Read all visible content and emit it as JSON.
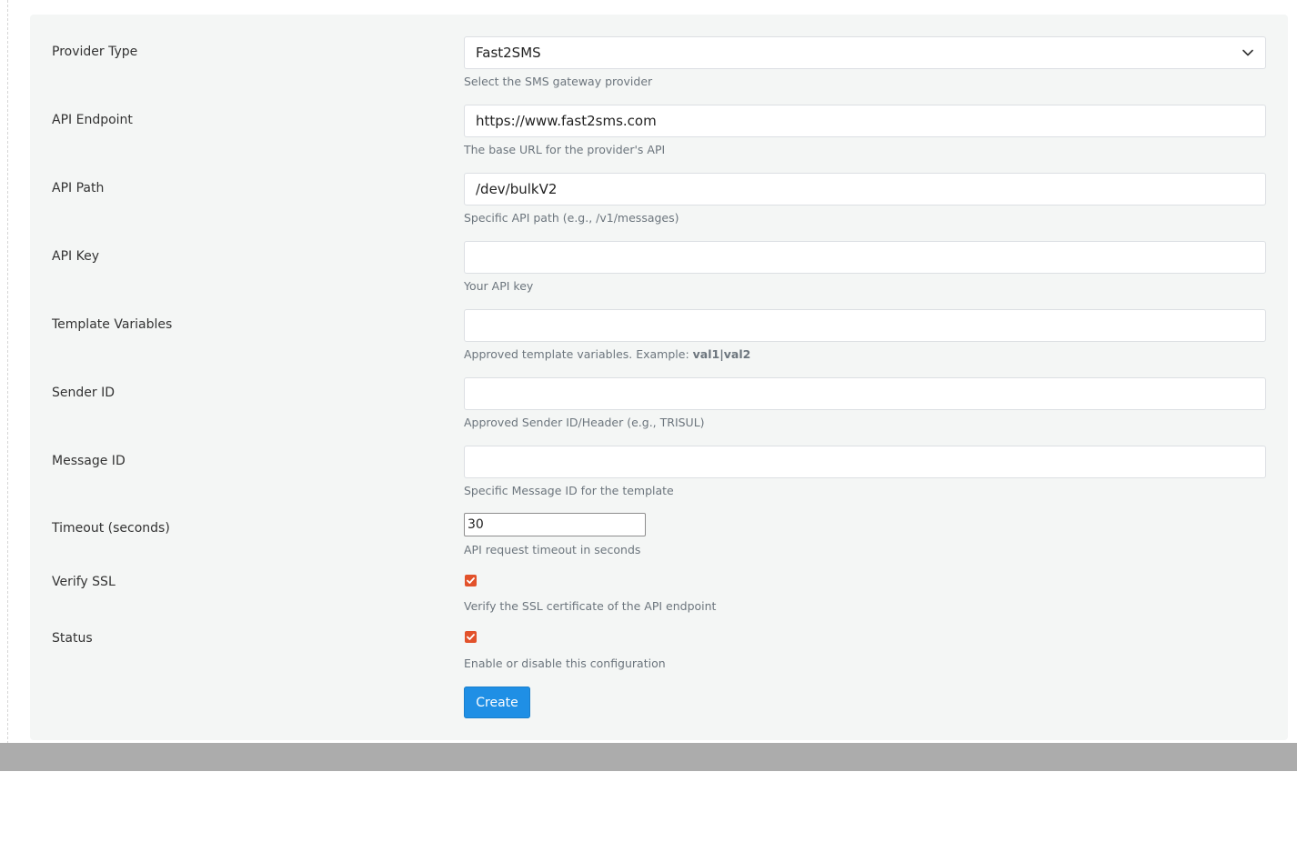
{
  "form": {
    "provider_type": {
      "label": "Provider Type",
      "value": "Fast2SMS",
      "help": "Select the SMS gateway provider"
    },
    "api_endpoint": {
      "label": "API Endpoint",
      "value": "https://www.fast2sms.com",
      "help": "The base URL for the provider's API"
    },
    "api_path": {
      "label": "API Path",
      "value": "/dev/bulkV2",
      "help": "Specific API path (e.g., /v1/messages)"
    },
    "api_key": {
      "label": "API Key",
      "value": "",
      "help": "Your API key"
    },
    "template_variables": {
      "label": "Template Variables",
      "value": "",
      "help_prefix": "Approved template variables. Example: ",
      "help_example": "val1|val2"
    },
    "sender_id": {
      "label": "Sender ID",
      "value": "",
      "help": "Approved Sender ID/Header (e.g., TRISUL)"
    },
    "message_id": {
      "label": "Message ID",
      "value": "",
      "help": "Specific Message ID for the template"
    },
    "timeout": {
      "label": "Timeout (seconds)",
      "value": "30",
      "help": "API request timeout in seconds"
    },
    "verify_ssl": {
      "label": "Verify SSL",
      "checked": true,
      "help": "Verify the SSL certificate of the API endpoint"
    },
    "status": {
      "label": "Status",
      "checked": true,
      "help": "Enable or disable this configuration"
    },
    "submit_label": "Create"
  },
  "colors": {
    "checkbox": "#e2522b",
    "primary_button": "#1f8fe5",
    "card_background": "#f4f6f5",
    "footer_bar": "#acacac"
  }
}
